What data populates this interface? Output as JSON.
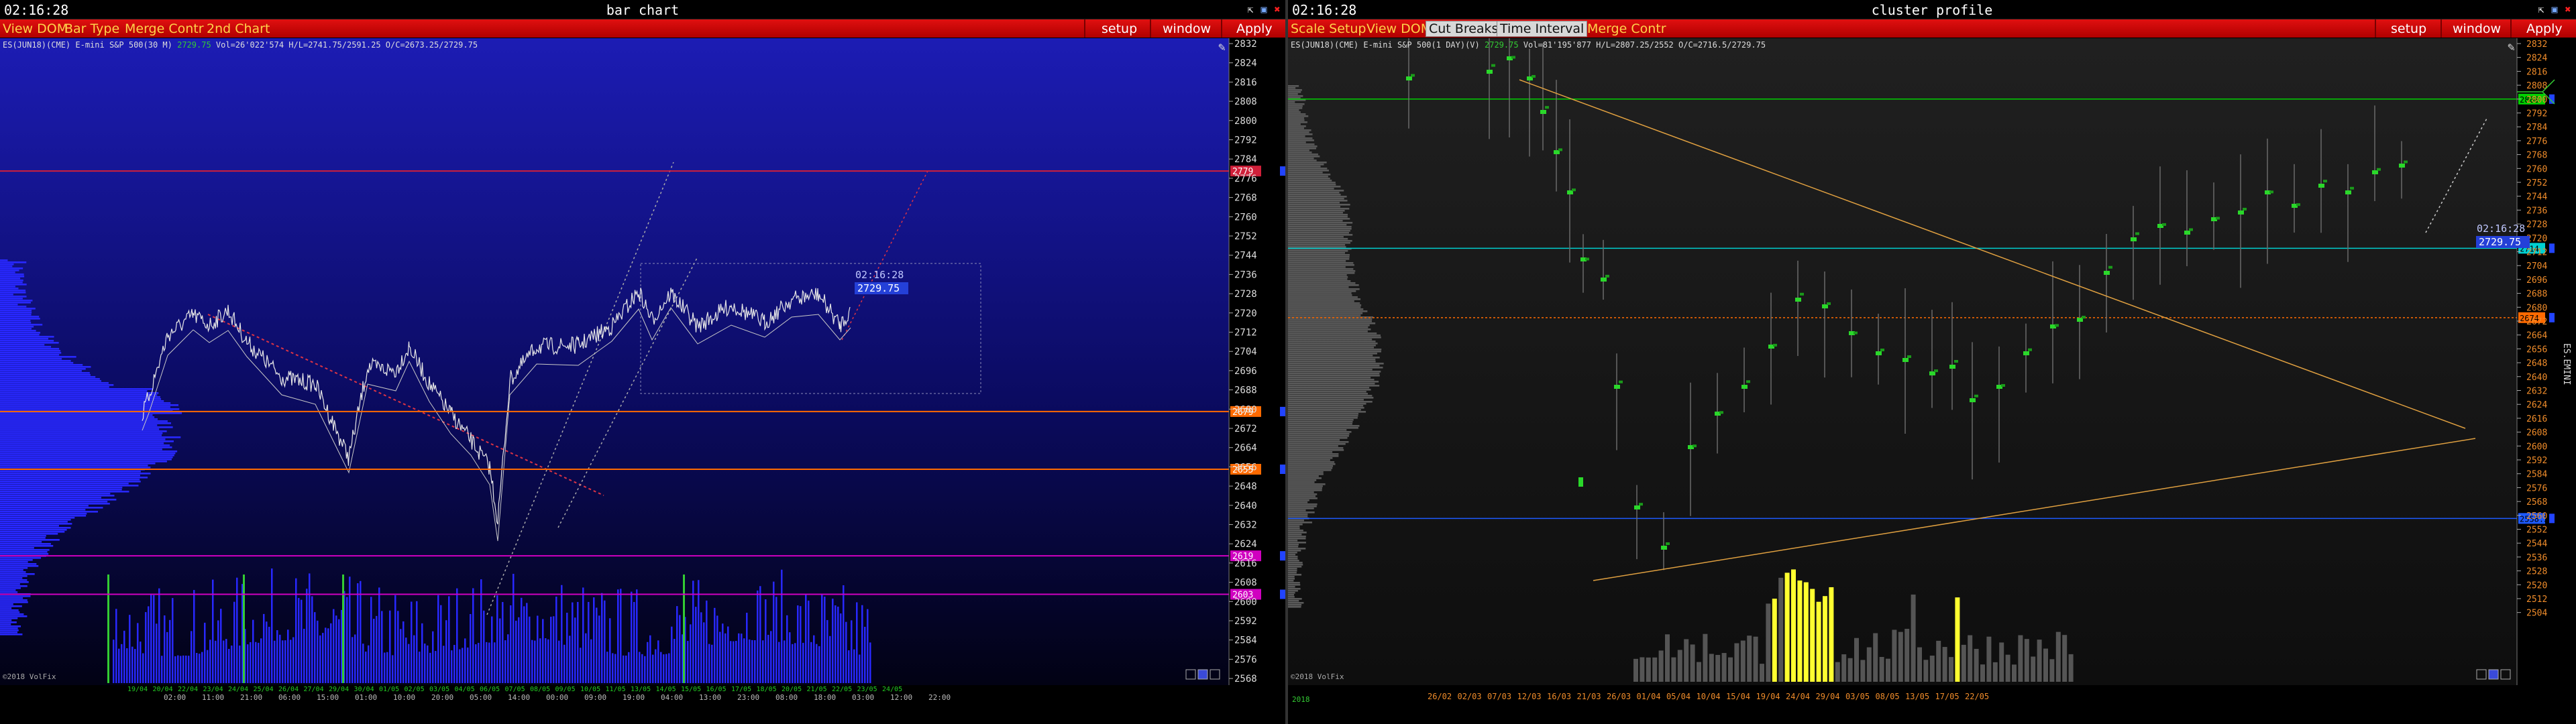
{
  "left": {
    "time": "02:16:28",
    "title": "bar chart",
    "menu": [
      "View DOM",
      "Bar Type",
      "Merge Contr",
      "2nd Chart"
    ],
    "menu_right": [
      "setup",
      "window",
      "Apply"
    ],
    "info_prefix": "ES(JUN18)(CME) E-mini S&P 500(30 M)",
    "info_price": "2729.75",
    "info_rest": "Vol=26'022'574 H/L=2741.75/2591.25 O/C=2673.25/2729.75",
    "copyright": "©2018 VolFix",
    "price_ticks": [
      "2832",
      "2824",
      "2816",
      "2808",
      "2800",
      "2792",
      "2784",
      "2776",
      "2768",
      "2760",
      "2752",
      "2744",
      "2736",
      "2728",
      "2720",
      "2712",
      "2704",
      "2696",
      "2688",
      "2680",
      "2672",
      "2664",
      "2656",
      "2648",
      "2640",
      "2632",
      "2624",
      "2616",
      "2608",
      "2600",
      "2592",
      "2584",
      "2576",
      "2568"
    ],
    "levels": [
      {
        "price": "2779",
        "color": "#d0203a"
      },
      {
        "price": "2679",
        "color": "#ff6a00"
      },
      {
        "price": "2655",
        "color": "#ff6a00"
      },
      {
        "price": "2619",
        "color": "#d000c0"
      },
      {
        "price": "2603",
        "color": "#d000c0"
      }
    ],
    "last_time": "02:16:28",
    "last_price": "2729.75",
    "date_labels": [
      "19/04",
      "20/04",
      "22/04",
      "23/04",
      "24/04",
      "25/04",
      "26/04",
      "27/04",
      "29/04",
      "30/04",
      "01/05",
      "02/05",
      "03/05",
      "04/05",
      "06/05",
      "07/05",
      "08/05",
      "09/05",
      "10/05",
      "11/05",
      "13/05",
      "14/05",
      "15/05",
      "16/05",
      "17/05",
      "18/05",
      "20/05",
      "21/05",
      "22/05",
      "23/05",
      "24/05"
    ],
    "time_labels": [
      "02:00",
      "11:00",
      "21:00",
      "06:00",
      "15:00",
      "01:00",
      "10:00",
      "20:00",
      "05:00",
      "14:00",
      "00:00",
      "09:00",
      "19:00",
      "04:00",
      "13:00",
      "23:00",
      "08:00",
      "18:00",
      "03:00",
      "12:00",
      "22:00"
    ]
  },
  "right": {
    "time": "02:16:28",
    "title": "cluster profile",
    "menu": [
      "Scale Setup",
      "View DOM",
      "Cut Breaks",
      "Time Interval",
      "Merge Contr"
    ],
    "menu_right": [
      "setup",
      "window",
      "Apply"
    ],
    "info_prefix": "ES(JUN18)(CME) E-mini S&P 500(1 DAY)(V)",
    "info_price": "2729.75",
    "info_rest": "Vol=81'195'877 H/L=2807.25/2552 O/C=2716.5/2729.75",
    "copyright": "©2018 VolFix",
    "price_ticks": [
      "2832",
      "2824",
      "2816",
      "2808",
      "2800",
      "2792",
      "2784",
      "2776",
      "2768",
      "2760",
      "2752",
      "2744",
      "2736",
      "2728",
      "2720",
      "2712",
      "2704",
      "2696",
      "2688",
      "2680",
      "2672",
      "2664",
      "2656",
      "2648",
      "2640",
      "2632",
      "2624",
      "2616",
      "2608",
      "2600",
      "2592",
      "2584",
      "2576",
      "2568",
      "2560",
      "2552",
      "2544",
      "2536",
      "2528",
      "2520",
      "2512",
      "2504"
    ],
    "levels": [
      {
        "price": "2800",
        "color": "#00d000"
      },
      {
        "price": "2714",
        "color": "#00d0d0"
      },
      {
        "price": "2674",
        "color": "#ff6a00"
      },
      {
        "price": "2558.25",
        "color": "#1e5aff"
      }
    ],
    "last_time": "02:16:28",
    "last_price": "2729.75",
    "side_label": "ES.EMINI",
    "year_label": "2018",
    "date_labels": [
      "26/02",
      "02/03",
      "07/03",
      "12/03",
      "16/03",
      "21/03",
      "26/03",
      "01/04",
      "05/04",
      "10/04",
      "15/04",
      "19/04",
      "24/04",
      "29/04",
      "03/05",
      "08/05",
      "13/05",
      "17/05",
      "22/05"
    ]
  },
  "colors": {
    "menubar": "#d00000",
    "menu_text": "#ffd24a",
    "bars": "#2828ff",
    "price_line": "#e6e6e6",
    "cluster_green": "#2ad82a",
    "volume_yellow": "#ffff30"
  }
}
